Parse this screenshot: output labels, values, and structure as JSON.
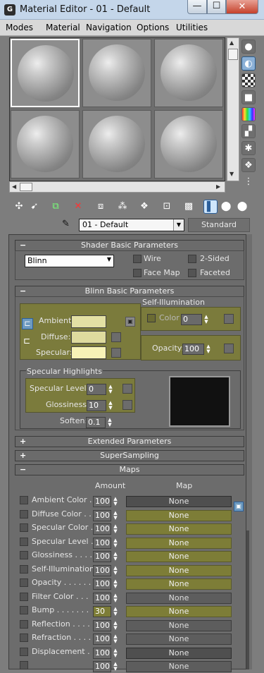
{
  "window": {
    "title": "Material Editor - 01 - Default",
    "app_icon": "G",
    "minimize": "—",
    "maximize": "☐",
    "close": "✕"
  },
  "menu": [
    "Modes",
    "Material",
    "Navigation",
    "Options",
    "Utilities"
  ],
  "material": {
    "name": "01 - Default",
    "type": "Standard"
  },
  "shader_basic": {
    "title": "Shader Basic Parameters",
    "shader": "Blinn",
    "wire": "Wire",
    "two_sided": "2-Sided",
    "face_map": "Face Map",
    "faceted": "Faceted"
  },
  "blinn_basic": {
    "title": "Blinn Basic Parameters",
    "self_illum_title": "Self-Illumination",
    "color_label": "Color",
    "color_value": "0",
    "ambient": "Ambient:",
    "diffuse": "Diffuse:",
    "specular": "Specular:",
    "opacity_label": "Opacity:",
    "opacity_value": "100",
    "ambient_color": "#e3e0a4",
    "diffuse_color": "#dedb9e",
    "specular_color": "#f7f3b6"
  },
  "specular_highlights": {
    "title": "Specular Highlights",
    "level_label": "Specular Level:",
    "level_value": "0",
    "gloss_label": "Glossiness:",
    "gloss_value": "10",
    "soften_label": "Soften:",
    "soften_value": "0.1"
  },
  "rollouts": {
    "extended": "Extended Parameters",
    "supersampling": "SuperSampling",
    "maps": "Maps"
  },
  "maps": {
    "amount_header": "Amount",
    "map_header": "Map",
    "rows": [
      {
        "label": "Ambient Color . .",
        "amount": "100",
        "map": "None"
      },
      {
        "label": "Diffuse Color . . .",
        "amount": "100",
        "map": "None"
      },
      {
        "label": "Specular Color  .",
        "amount": "100",
        "map": "None"
      },
      {
        "label": "Specular Level  .",
        "amount": "100",
        "map": "None"
      },
      {
        "label": "Glossiness  . . . .",
        "amount": "100",
        "map": "None"
      },
      {
        "label": "Self-Illumination .",
        "amount": "100",
        "map": "None"
      },
      {
        "label": "Opacity . . . . . .",
        "amount": "100",
        "map": "None"
      },
      {
        "label": "Filter Color  . . .",
        "amount": "100",
        "map": "None"
      },
      {
        "label": "Bump  . . . . . . .",
        "amount": "30",
        "map": "None"
      },
      {
        "label": "Reflection  . . . .",
        "amount": "100",
        "map": "None"
      },
      {
        "label": "Refraction  . . . .",
        "amount": "100",
        "map": "None"
      },
      {
        "label": "Displacement  . .",
        "amount": "100",
        "map": "None"
      },
      {
        "label": "",
        "amount": "100",
        "map": "None"
      }
    ]
  }
}
